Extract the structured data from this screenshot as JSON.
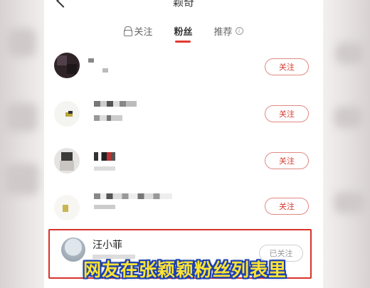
{
  "header": {
    "title": "颖奇"
  },
  "tabs": [
    {
      "label": "关注",
      "icon": "lock-icon"
    },
    {
      "label": "粉丝"
    },
    {
      "label": "推荐",
      "icon": "info-icon"
    }
  ],
  "rows": [
    {
      "button": "关注"
    },
    {
      "button": "关注"
    },
    {
      "button": "关注"
    },
    {
      "button": "关注"
    }
  ],
  "highlighted_user": {
    "name": "汪小菲",
    "button": "已关注"
  },
  "caption": "网友在张颖颖粉丝列表里",
  "colors": {
    "accent": "#e33a2f",
    "caption_fill": "#ffe433",
    "caption_stroke": "#1b3fb0",
    "highlight_border": "#d9322a"
  }
}
